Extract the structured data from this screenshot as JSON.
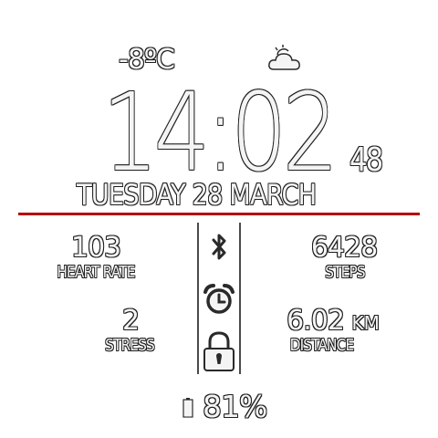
{
  "weather": {
    "temperature": "-8ºC",
    "condition_icon": "partly-cloudy-icon"
  },
  "clock": {
    "time": "14:02",
    "seconds": "48",
    "date": "TUESDAY 28 MARCH"
  },
  "stats": {
    "heart_rate": {
      "value": "103",
      "label": "HEART RATE"
    },
    "steps": {
      "value": "6428",
      "label": "STEPS"
    },
    "stress": {
      "value": "2",
      "label": "STRESS"
    },
    "distance": {
      "value": "6.02",
      "unit": "KM",
      "label": "DISTANCE"
    }
  },
  "status_icons": [
    "bluetooth-icon",
    "alarm-icon",
    "lock-icon"
  ],
  "battery": {
    "percent": "81%",
    "level": 0.81
  },
  "colors": {
    "accent": "#b40000",
    "background": "#ffffff",
    "text": "#f4f4f4",
    "outline": "#1e1e1e"
  }
}
